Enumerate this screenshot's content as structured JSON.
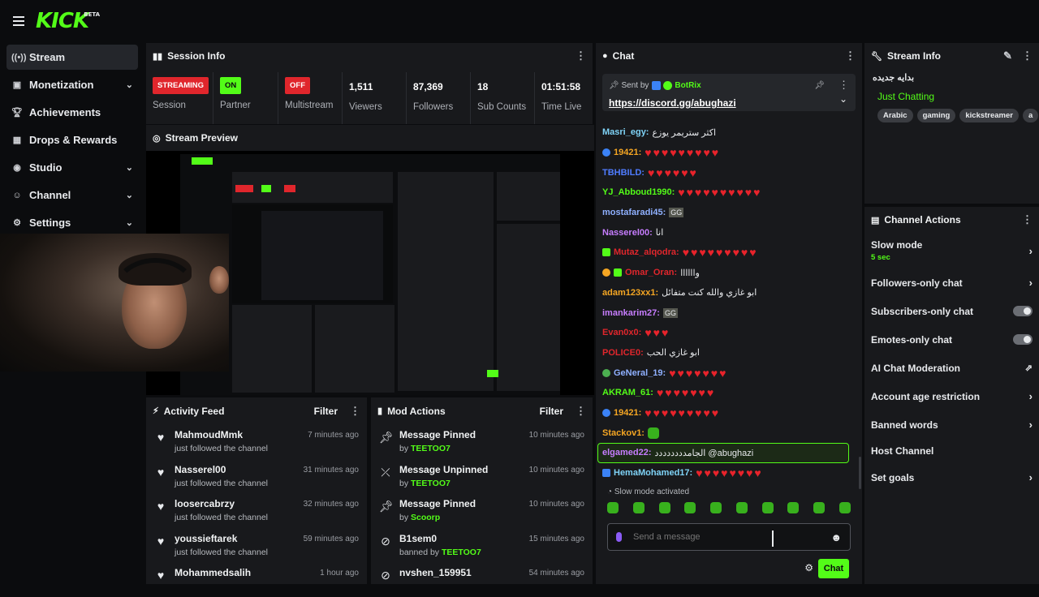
{
  "topbar": {
    "logo": "KICK",
    "logo_badge": "BETA"
  },
  "sidebar": {
    "items": [
      {
        "label": "Stream",
        "icon": "radio-icon",
        "active": true
      },
      {
        "label": "Monetization",
        "icon": "money-icon",
        "expandable": true
      },
      {
        "label": "Achievements",
        "icon": "trophy-icon"
      },
      {
        "label": "Drops & Rewards",
        "icon": "gift-icon"
      },
      {
        "label": "Studio",
        "icon": "camera-icon",
        "expandable": true
      },
      {
        "label": "Channel",
        "icon": "user-icon",
        "expandable": true
      },
      {
        "label": "Settings",
        "icon": "gear-icon",
        "expandable": true
      }
    ]
  },
  "session": {
    "title": "Session Info",
    "stats": [
      {
        "badge": "STREAMING",
        "caption": "Session"
      },
      {
        "badge": "ON",
        "caption": "Partner"
      },
      {
        "badge": "OFF",
        "caption": "Multistream"
      },
      {
        "value": "1,511",
        "caption": "Viewers"
      },
      {
        "value": "87,369",
        "caption": "Followers"
      },
      {
        "value": "18",
        "caption": "Sub Counts"
      },
      {
        "value": "01:51:58",
        "caption": "Time Live"
      }
    ]
  },
  "preview": {
    "title": "Stream Preview"
  },
  "activity": {
    "title": "Activity Feed",
    "filter_label": "Filter",
    "rows": [
      {
        "name": "MahmoudMmk",
        "sub": "just followed the channel",
        "time": "7 minutes ago"
      },
      {
        "name": "Nasserel00",
        "sub": "just followed the channel",
        "time": "31 minutes ago"
      },
      {
        "name": "loosercabrzy",
        "sub": "just followed the channel",
        "time": "32 minutes ago"
      },
      {
        "name": "youssieftarek",
        "sub": "just followed the channel",
        "time": "59 minutes ago"
      },
      {
        "name": "Mohammedsalih",
        "sub": "",
        "time": "1 hour ago"
      }
    ]
  },
  "mod": {
    "title": "Mod Actions",
    "filter_label": "Filter",
    "rows": [
      {
        "name": "Message Pinned",
        "prefix": "by",
        "user": "TEETOO7",
        "time": "10 minutes ago",
        "icon": "pin-icon"
      },
      {
        "name": "Message Unpinned",
        "prefix": "by",
        "user": "TEETOO7",
        "time": "10 minutes ago",
        "icon": "unpin-icon"
      },
      {
        "name": "Message Pinned",
        "prefix": "by",
        "user": "Scoorp",
        "time": "10 minutes ago",
        "icon": "pin-icon"
      },
      {
        "name": "B1sem0",
        "prefix": "banned by",
        "user": "TEETOO7",
        "time": "15 minutes ago",
        "icon": "ban-icon"
      },
      {
        "name": "nvshen_159951",
        "prefix": "",
        "user": "",
        "time": "54 minutes ago",
        "icon": "ban-icon"
      }
    ]
  },
  "chat": {
    "title": "Chat",
    "pinned": {
      "sent_by": "Sent by",
      "bot": "BotRix",
      "link": "https://discord.gg/abughazi"
    },
    "messages": [
      {
        "user": "Masri_egy:",
        "color": "#7fd3f7",
        "text": "اكثر ستريمر يوزع"
      },
      {
        "user": "19421:",
        "color": "#f5a623",
        "hearts": 9
      },
      {
        "user": "TBHBILD:",
        "color": "#4f7cff",
        "hearts": 6
      },
      {
        "user": "YJ_Abboud1990:",
        "color": "#53fc18",
        "hearts": 10
      },
      {
        "user": "mostafaradi45:",
        "color": "#8fb0ff",
        "text": "GG"
      },
      {
        "user": "Nasserel00:",
        "color": "#c77dff",
        "text": "انا"
      },
      {
        "user": "Mutaz_alqodra:",
        "color": "#e0262c",
        "hearts": 9
      },
      {
        "user": "Omar_Oran:",
        "color": "#e0262c",
        "text": "واااااا"
      },
      {
        "user": "adam123xx1:",
        "color": "#f5a623",
        "text": "ابو غازي والله كنت متفائل"
      },
      {
        "user": "imankarim27:",
        "color": "#c77dff",
        "text": "GG"
      },
      {
        "user": "Evan0x0:",
        "color": "#e0262c",
        "hearts": 3
      },
      {
        "user": "POLICE0:",
        "color": "#e0262c",
        "text": "ابو غازي الحب"
      },
      {
        "user": "GeNeral_19:",
        "color": "#8fb0ff",
        "hearts": 7
      },
      {
        "user": "AKRAM_61:",
        "color": "#53fc18",
        "hearts": 7
      },
      {
        "user": "19421:",
        "color": "#f5a623",
        "hearts": 9
      },
      {
        "user": "Stackov1:",
        "color": "#f5a623",
        "text": ""
      },
      {
        "user": "elgamed22:",
        "color": "#c77dff",
        "text": "الجامدددددددد @abughazi",
        "highlight": true
      },
      {
        "user": "HemaMohamed17:",
        "color": "#7fd3f7",
        "hearts": 8
      }
    ],
    "slow_mode_notice": "Slow mode activated",
    "input_placeholder": "Send a message",
    "send_label": "Chat"
  },
  "stream_info": {
    "title": "Stream Info",
    "stream_title": "بدايه جديده",
    "category": "Just Chatting",
    "tags": [
      "Arabic",
      "gaming",
      "kickstreamer",
      "a"
    ]
  },
  "channel_actions": {
    "title": "Channel Actions",
    "items": [
      {
        "label": "Slow mode",
        "sub": "5 sec",
        "control": "chevron"
      },
      {
        "label": "Followers-only chat",
        "control": "chevron"
      },
      {
        "label": "Subscribers-only chat",
        "control": "toggle"
      },
      {
        "label": "Emotes-only chat",
        "control": "toggle"
      },
      {
        "label": "AI Chat Moderation",
        "control": "external"
      },
      {
        "label": "Account age restriction",
        "control": "chevron"
      },
      {
        "label": "Banned words",
        "control": "chevron"
      },
      {
        "label": "Host Channel",
        "control": "none"
      },
      {
        "label": "Set goals",
        "control": "chevron"
      }
    ]
  },
  "colors": {
    "accent": "#53fc18",
    "streaming": "#e0262c",
    "panel": "#18191c"
  }
}
